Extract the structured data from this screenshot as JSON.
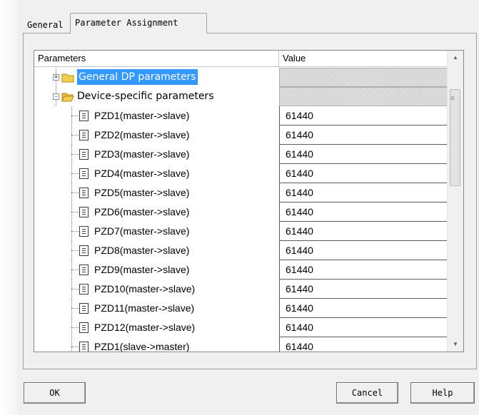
{
  "tabs": [
    {
      "label": "General",
      "active": false
    },
    {
      "label": "Parameter Assignment",
      "active": true
    }
  ],
  "grid": {
    "columns": {
      "parameters": "Parameters",
      "value": "Value"
    },
    "rows": [
      {
        "kind": "group",
        "expander": "+",
        "label": "General DP parameters",
        "value": "",
        "selected": true,
        "hatched": true
      },
      {
        "kind": "group",
        "expander": "-",
        "label": "Device-specific parameters",
        "value": "",
        "selected": false,
        "hatched": true
      },
      {
        "kind": "item",
        "label": "PZD1(master->slave)",
        "value": "61440"
      },
      {
        "kind": "item",
        "label": "PZD2(master->slave)",
        "value": "61440"
      },
      {
        "kind": "item",
        "label": "PZD3(master->slave)",
        "value": "61440"
      },
      {
        "kind": "item",
        "label": "PZD4(master->slave)",
        "value": "61440"
      },
      {
        "kind": "item",
        "label": "PZD5(master->slave)",
        "value": "61440"
      },
      {
        "kind": "item",
        "label": "PZD6(master->slave)",
        "value": "61440"
      },
      {
        "kind": "item",
        "label": "PZD7(master->slave)",
        "value": "61440"
      },
      {
        "kind": "item",
        "label": "PZD8(master->slave)",
        "value": "61440"
      },
      {
        "kind": "item",
        "label": "PZD9(master->slave)",
        "value": "61440"
      },
      {
        "kind": "item",
        "label": "PZD10(master->slave)",
        "value": "61440"
      },
      {
        "kind": "item",
        "label": "PZD11(master->slave)",
        "value": "61440"
      },
      {
        "kind": "item",
        "label": "PZD12(master->slave)",
        "value": "61440"
      },
      {
        "kind": "item",
        "label": "PZD1(slave->master)",
        "value": "61440"
      }
    ]
  },
  "icons": {
    "folder": "folder-icon",
    "document": "document-icon",
    "scroll_up": "arrow-up-icon",
    "scroll_down": "arrow-down-icon"
  },
  "buttons": {
    "ok": "OK",
    "cancel": "Cancel",
    "help": "Help"
  },
  "colors": {
    "selection": "#3399ff",
    "folder": "#f2cf4a"
  }
}
